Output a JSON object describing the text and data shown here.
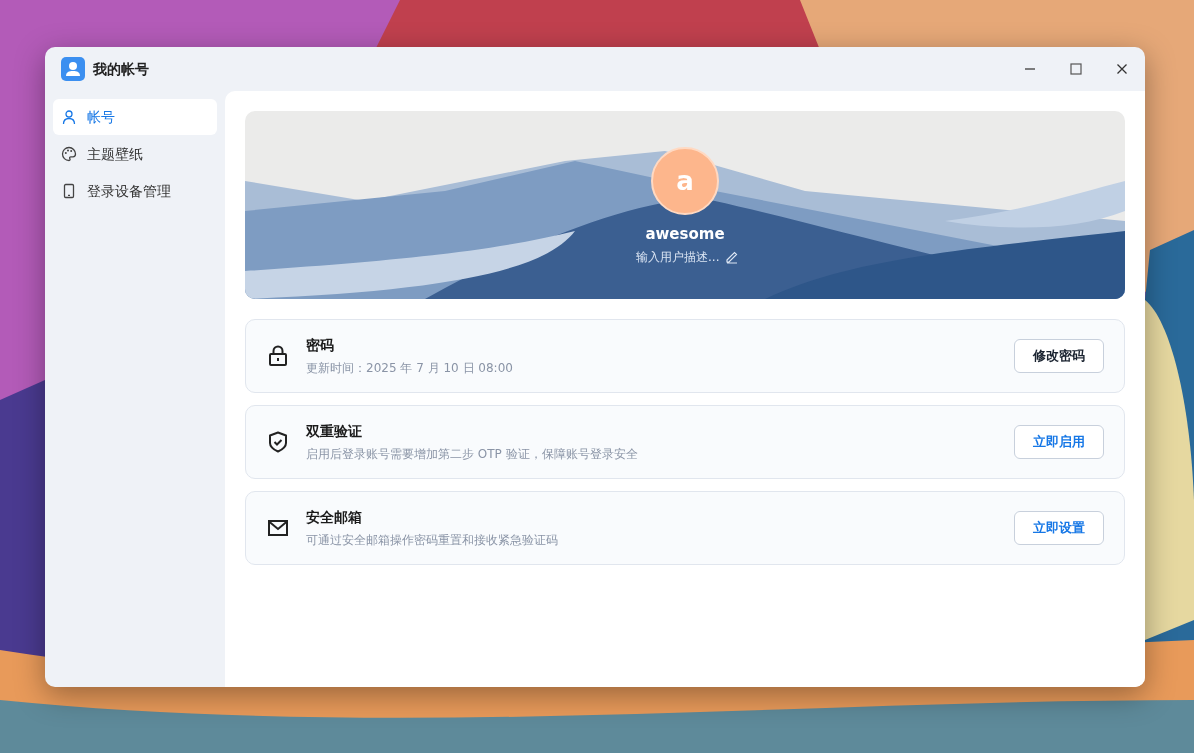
{
  "window": {
    "title": "我的帐号"
  },
  "sidebar": {
    "items": [
      {
        "label": "帐号",
        "selected": true
      },
      {
        "label": "主题壁纸",
        "selected": false
      },
      {
        "label": "登录设备管理",
        "selected": false
      }
    ]
  },
  "profile": {
    "avatar_letter": "a",
    "username": "awesome",
    "description": {
      "placeholder": "输入用户描述..."
    }
  },
  "settings": [
    {
      "kind": "lock",
      "title": "密码",
      "description": "更新时间：2025 年 7 月 10 日 08:00",
      "button": "修改密码"
    },
    {
      "kind": "shield",
      "title": "双重验证",
      "description": "启用后登录账号需要增加第二步 OTP 验证，保障账号登录安全",
      "button": "立即启用"
    },
    {
      "kind": "mail",
      "title": "安全邮箱",
      "description": "可通过安全邮箱操作密码重置和接收紧急验证码",
      "button": "立即设置"
    }
  ]
}
